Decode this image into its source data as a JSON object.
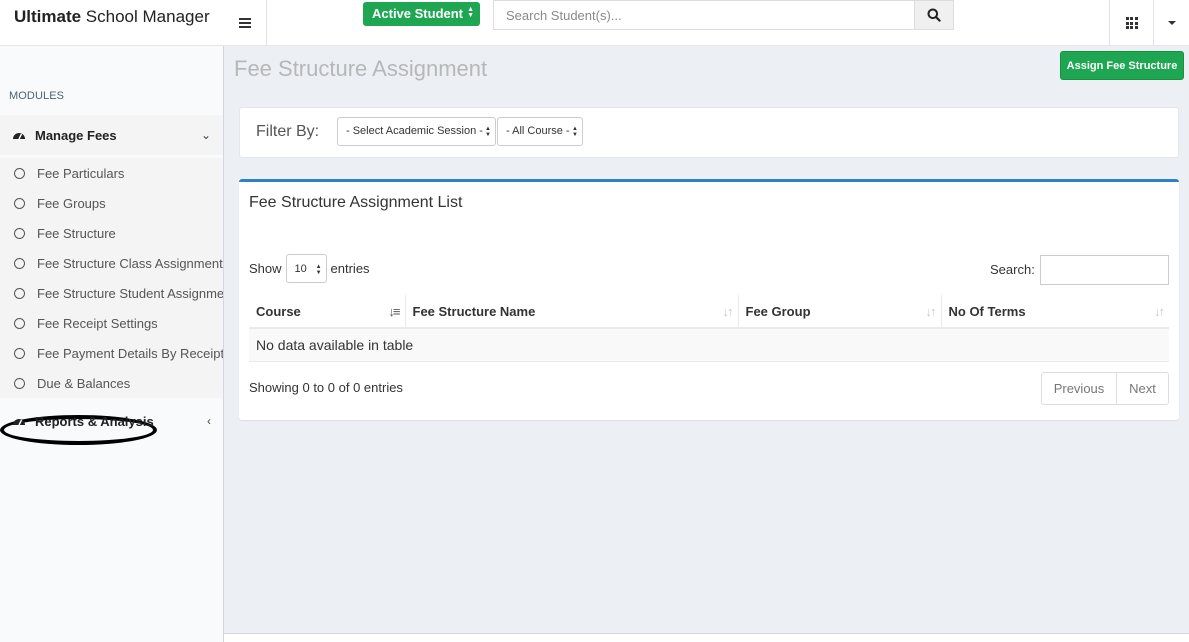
{
  "header": {
    "brand_bold": "Ultimate",
    "brand_rest": " School Manager",
    "student_status": "Active Student",
    "search_placeholder": "Search Student(s)..."
  },
  "sidebar": {
    "section_label": "MODULES",
    "manage_fees": "Manage Fees",
    "items": [
      {
        "label": "Fee Particulars"
      },
      {
        "label": "Fee Groups"
      },
      {
        "label": "Fee Structure"
      },
      {
        "label": "Fee Structure Class Assignment"
      },
      {
        "label": "Fee Structure Student Assignment"
      },
      {
        "label": "Fee Receipt Settings"
      },
      {
        "label": "Fee Payment Details By Receipt No"
      },
      {
        "label": "Due & Balances"
      }
    ],
    "reports": "Reports & Analysis"
  },
  "page": {
    "title": "Fee Structure Assignment",
    "assign_button": "Assign Fee Structure"
  },
  "filter": {
    "label": "Filter By:",
    "session": "- Select Academic Session -",
    "course": "- All Course -"
  },
  "list": {
    "title": "Fee Structure Assignment List",
    "show_label": "Show",
    "entries_label": "entries",
    "page_length": "10",
    "search_label": "Search:",
    "columns": [
      "Course",
      "Fee Structure Name",
      "Fee Group",
      "No Of Terms"
    ],
    "empty_message": "No data available in table",
    "info": "Showing 0 to 0 of 0 entries",
    "prev": "Previous",
    "next": "Next"
  },
  "colors": {
    "accent_green": "#1fa652",
    "box_top_blue": "#2b82c7"
  }
}
